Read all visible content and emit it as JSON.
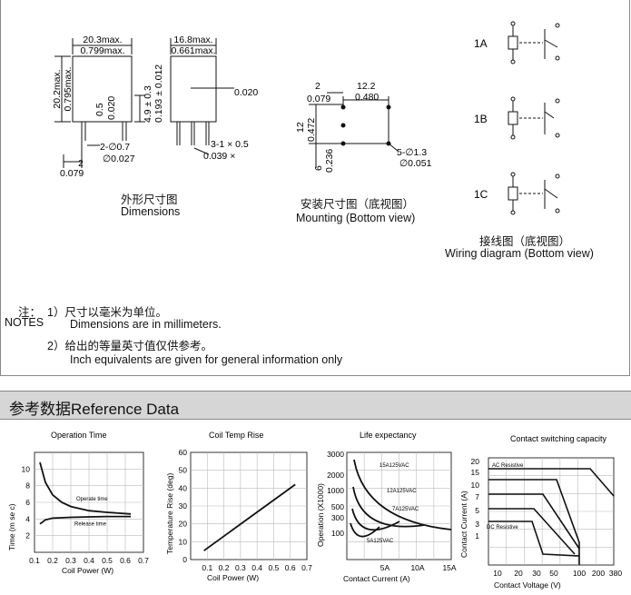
{
  "dimensions": {
    "front": {
      "w_mm": "20.3max.",
      "w_in": "0.799max.",
      "h_mm": "20.2max.",
      "h_in": "0.795max.",
      "pin_h": "0.5",
      "pin_h_in": "0.020",
      "height": "4.9 ± 0.3",
      "height_in": "0.193 ± 0.012",
      "pin_dia": "2-∅0.7",
      "pin_dia_in": "∅0.027",
      "pitch": "2",
      "pitch_in": "0.079"
    },
    "side": {
      "w_mm": "16.8max.",
      "w_in": "0.661max.",
      "t_in": "0.020",
      "pins": "3-1 × 0.5",
      "pins_in": "0.039 ×"
    },
    "caption_cn": "外形尺寸图",
    "caption_en": "Dimensions"
  },
  "mounting": {
    "d1": "2",
    "d1_in": "0.079",
    "d2": "12.2",
    "d2_in": "0.480",
    "v1": "12",
    "v1_in": "0.472",
    "v2": "6",
    "v2_in": "0.236",
    "holes": "5-∅1.3",
    "holes_in": "∅0.051",
    "caption_cn": "安装尺寸图（底视图）",
    "caption_en": "Mounting (Bottom view)"
  },
  "wiring": {
    "labels": [
      "1A",
      "1B",
      "1C"
    ],
    "caption_cn": "接线图（底视图）",
    "caption_en": "Wiring diagram (Bottom view)"
  },
  "notes": {
    "label_cn": "注：",
    "label_en": "NOTES",
    "n1_cn": "1）尺寸以毫米为单位。",
    "n1_en": "Dimensions are in millimeters.",
    "n2_cn": "2）给出的等量英寸值仅供参考。",
    "n2_en": "Inch equivalents are given for general information only"
  },
  "reference_title": "参考数据Reference Data",
  "chart_data": [
    {
      "type": "line",
      "title": "Operation Time",
      "xlabel": "Coil Power (W)",
      "ylabel": "Time (m se c)",
      "xlim": [
        0.1,
        0.7
      ],
      "ylim": [
        0,
        12
      ],
      "x_ticks": [
        "0.1",
        "0.2",
        "0.3",
        "0.4",
        "0.5",
        "0.6",
        "0.7"
      ],
      "y_ticks": [
        "2",
        "4",
        "6",
        "8",
        "10"
      ],
      "series": [
        {
          "name": "Operate time",
          "x": [
            0.13,
            0.16,
            0.2,
            0.25,
            0.3,
            0.4,
            0.5,
            0.63
          ],
          "y": [
            10.8,
            8.4,
            6.9,
            6.0,
            5.5,
            5.0,
            4.8,
            4.6
          ]
        },
        {
          "name": "Release time",
          "x": [
            0.13,
            0.16,
            0.2,
            0.3,
            0.4,
            0.5,
            0.63
          ],
          "y": [
            3.4,
            3.9,
            4.1,
            4.2,
            4.25,
            4.3,
            4.3
          ]
        }
      ]
    },
    {
      "type": "line",
      "title": "Coil Temp Rise",
      "xlabel": "Coil Power (W)",
      "ylabel": "Temperature Rise (deg)",
      "xlim": [
        0,
        0.7
      ],
      "ylim": [
        0,
        60
      ],
      "x_ticks": [
        "0.1",
        "0.2",
        "0.3",
        "0.4",
        "0.5",
        "0.6",
        "0.7"
      ],
      "y_ticks": [
        "0",
        "10",
        "20",
        "30",
        "40",
        "50",
        "60"
      ],
      "series": [
        {
          "name": "",
          "x": [
            0.08,
            0.63
          ],
          "y": [
            5,
            42
          ]
        }
      ]
    },
    {
      "type": "line",
      "title": "Life expectancy",
      "xlabel": "Contact Current (A)",
      "ylabel": "Operation (X1000)",
      "x_ticks": [
        "5A",
        "10A",
        "15A"
      ],
      "y_ticks": [
        "100",
        "300",
        "500",
        "1000",
        "2000",
        "3000"
      ],
      "annotations": [
        "15A125VAC",
        "12A125VAC",
        "7A125VAC",
        "5A125VAC"
      ]
    },
    {
      "type": "line",
      "title": "Contact switching capacity",
      "xlabel": "Contact Voltage (V)",
      "ylabel": "Contact Current (A)",
      "x_ticks": [
        "10",
        "20",
        "30",
        "50",
        "100",
        "200",
        "380"
      ],
      "y_ticks": [
        "1",
        "3",
        "5",
        "7",
        "10",
        "15",
        "20"
      ],
      "annotations": [
        "AC Resistive",
        "DC Resistive"
      ]
    }
  ]
}
